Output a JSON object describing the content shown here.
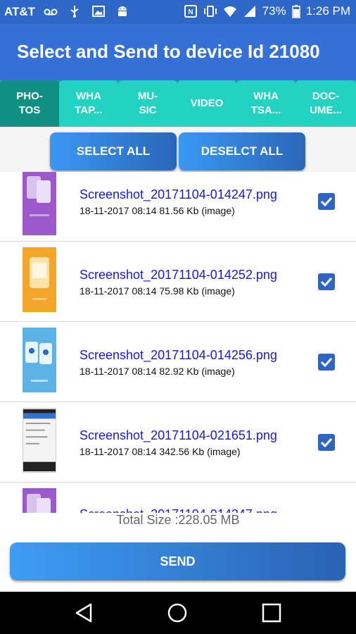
{
  "status_bar": {
    "carrier": "AT&T",
    "battery": "73%",
    "time": "1:26 PM"
  },
  "app_bar": {
    "title": "Select and Send to device Id 21080"
  },
  "tabs": [
    {
      "label": "PHO-\nTOS",
      "active": true
    },
    {
      "label": "WHA\nTAP...",
      "active": false
    },
    {
      "label": "MU-\nSIC",
      "active": false
    },
    {
      "label": "VIDEO",
      "active": false
    },
    {
      "label": "WHA\nTSA...",
      "active": false
    },
    {
      "label": "DOC-\nUME...",
      "active": false
    }
  ],
  "actions": {
    "select_all": "SELECT ALL",
    "deselect_all": "DESELCT ALL"
  },
  "files": [
    {
      "name": "Screenshot_20171104-014247.png",
      "meta": "18-11-2017 08:14 81.56 Kb (image)",
      "checked": true,
      "thumb_color": "#9b59c9"
    },
    {
      "name": "Screenshot_20171104-014252.png",
      "meta": "18-11-2017 08:14 75.98 Kb (image)",
      "checked": true,
      "thumb_color": "#f3a62a"
    },
    {
      "name": "Screenshot_20171104-014256.png",
      "meta": "18-11-2017 08:14 82.92 Kb (image)",
      "checked": true,
      "thumb_color": "#5db3e6"
    },
    {
      "name": "Screenshot_20171104-021651.png",
      "meta": "18-11-2017 08:14 342.56 Kb (image)",
      "checked": true,
      "thumb_color": "#f4f4f4"
    },
    {
      "name": "Screenshot_20171104-014247.png",
      "meta": "",
      "checked": true,
      "thumb_color": "#9b59c9"
    }
  ],
  "total_size": "Total Size :228.05 MB",
  "send_label": "SEND",
  "colors": {
    "status_bar": "#2f67c9",
    "app_bar": "#3470d6",
    "tab": "#22d3c2",
    "tab_active": "#108f83",
    "link": "#1a1ad9"
  }
}
